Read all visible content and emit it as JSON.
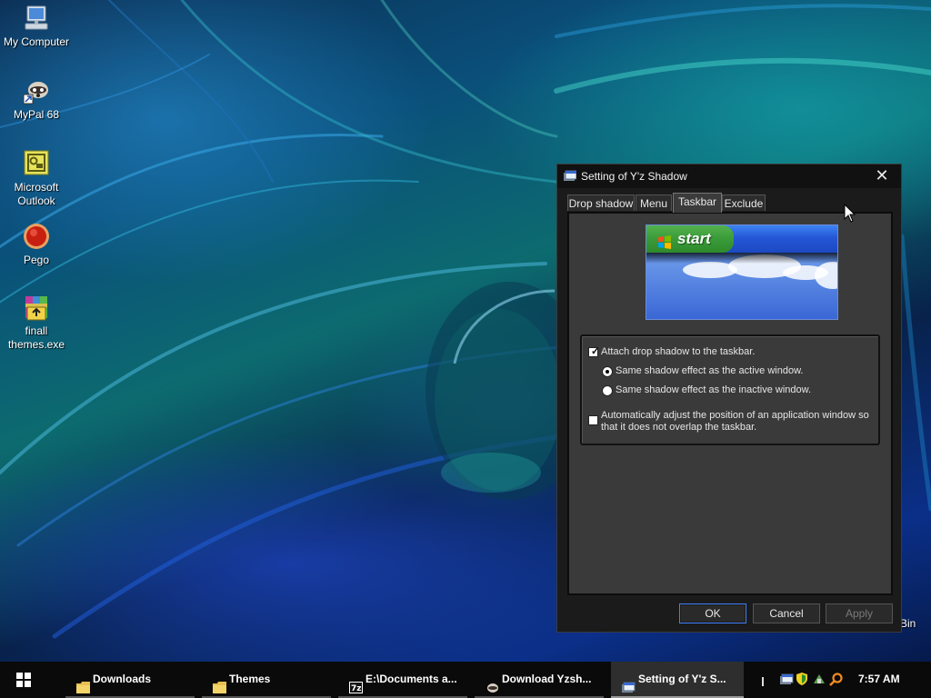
{
  "desktop": {
    "icons": [
      {
        "label_line1": "My Computer",
        "label_line2": ""
      },
      {
        "label_line1": "MyPal 68",
        "label_line2": ""
      },
      {
        "label_line1": "Microsoft",
        "label_line2": "Outlook"
      },
      {
        "label_line1": "Pego",
        "label_line2": ""
      },
      {
        "label_line1": "finall",
        "label_line2": "themes.exe"
      }
    ],
    "partial_recycle_label": "Bin"
  },
  "dialog": {
    "title": "Setting of Y'z Shadow",
    "close_glyph": "✕",
    "tabs": [
      {
        "label": "Drop shadow",
        "active": false
      },
      {
        "label": "Menu",
        "active": false
      },
      {
        "label": "Taskbar",
        "active": true
      },
      {
        "label": "Exclude",
        "active": false
      }
    ],
    "preview": {
      "start_label": "start"
    },
    "options": {
      "attach_label": "Attach drop shadow to the taskbar.",
      "attach_checked": true,
      "radio_active_label": "Same shadow effect as the active window.",
      "radio_active_selected": true,
      "radio_inactive_label": "Same shadow effect as the inactive window.",
      "radio_inactive_selected": false,
      "auto_adjust_line1": "Automatically adjust the position of an application window so",
      "auto_adjust_line2": "that it does not overlap the taskbar.",
      "auto_adjust_checked": false
    },
    "buttons": {
      "ok": "OK",
      "cancel": "Cancel",
      "apply": "Apply"
    }
  },
  "taskbar": {
    "tasks": [
      {
        "label": "Downloads",
        "icon": "folder-icon",
        "active": false
      },
      {
        "label": "Themes",
        "icon": "folder-icon",
        "active": false
      },
      {
        "label": "E:\\Documents a...",
        "icon": "7zip-icon",
        "active": false
      },
      {
        "label": "Download Yzsh...",
        "icon": "browser-icon",
        "active": false
      },
      {
        "label": "Setting of Y'z S...",
        "icon": "yzshadow-icon",
        "active": true
      }
    ],
    "clock": "7:57 AM"
  },
  "colors": {
    "taskbar_bg": "#0a0a0a",
    "dialog_bg": "#1b1b1b",
    "panel_bg": "#3a3a3a",
    "default_button_border": "#3f82ff",
    "xp_start_green": "#3a9a38",
    "xp_bar_blue": "#2456d6"
  }
}
